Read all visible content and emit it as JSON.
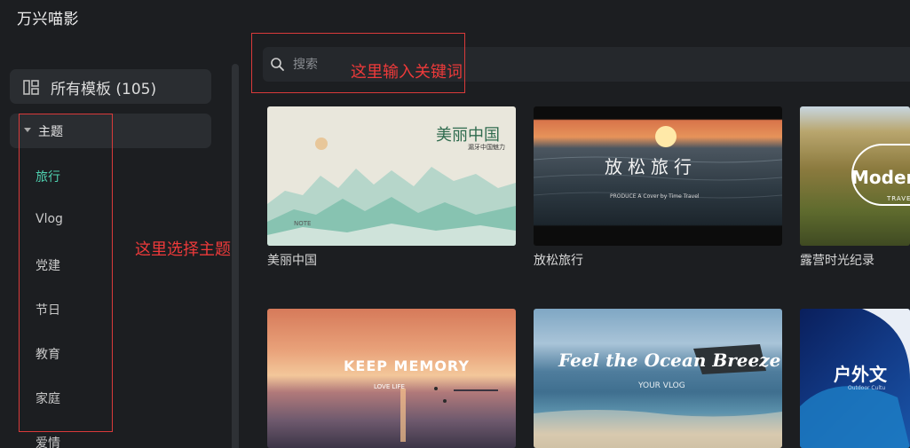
{
  "app": {
    "title": "万兴喵影"
  },
  "sidebar": {
    "all_templates": {
      "label": "所有模板 (105)",
      "icon": "layout-grid-icon"
    },
    "theme_section": {
      "label": "主题",
      "expanded": true
    },
    "topics": [
      {
        "label": "旅行",
        "active": true
      },
      {
        "label": "Vlog",
        "active": false
      },
      {
        "label": "党建",
        "active": false
      },
      {
        "label": "节日",
        "active": false
      },
      {
        "label": "教育",
        "active": false
      },
      {
        "label": "家庭",
        "active": false
      },
      {
        "label": "爱情",
        "active": false
      }
    ]
  },
  "search": {
    "placeholder": "搜索",
    "icon": "search-icon"
  },
  "annotations": {
    "search_hint": "这里输入关键词",
    "topic_hint": "这里选择主题"
  },
  "templates": [
    {
      "title": "美丽中国",
      "thumb_heading": "美丽中国",
      "thumb_sub": "漏牙中国魅力",
      "thumb_badge": "NOTE"
    },
    {
      "title": "放松旅行",
      "thumb_heading": "放松旅行",
      "thumb_sub": "PRODUCE A Cover by Time Travel"
    },
    {
      "title": "露营时光纪录",
      "thumb_heading": "Moder",
      "thumb_sub": "TRAVE"
    },
    {
      "title": "",
      "thumb_heading": "KEEP MEMORY",
      "thumb_sub": "LOVE LIFE"
    },
    {
      "title": "",
      "thumb_heading": "Feel the Ocean Breeze",
      "thumb_sub": "YOUR VLOG"
    },
    {
      "title": "",
      "thumb_heading": "户外文",
      "thumb_sub": "Outdoor Cultu"
    }
  ],
  "colors": {
    "accent_active": "#4fd1b0",
    "annotation_red": "#ee3a3a",
    "background": "#1c1e21",
    "panel": "#2a2d31"
  }
}
